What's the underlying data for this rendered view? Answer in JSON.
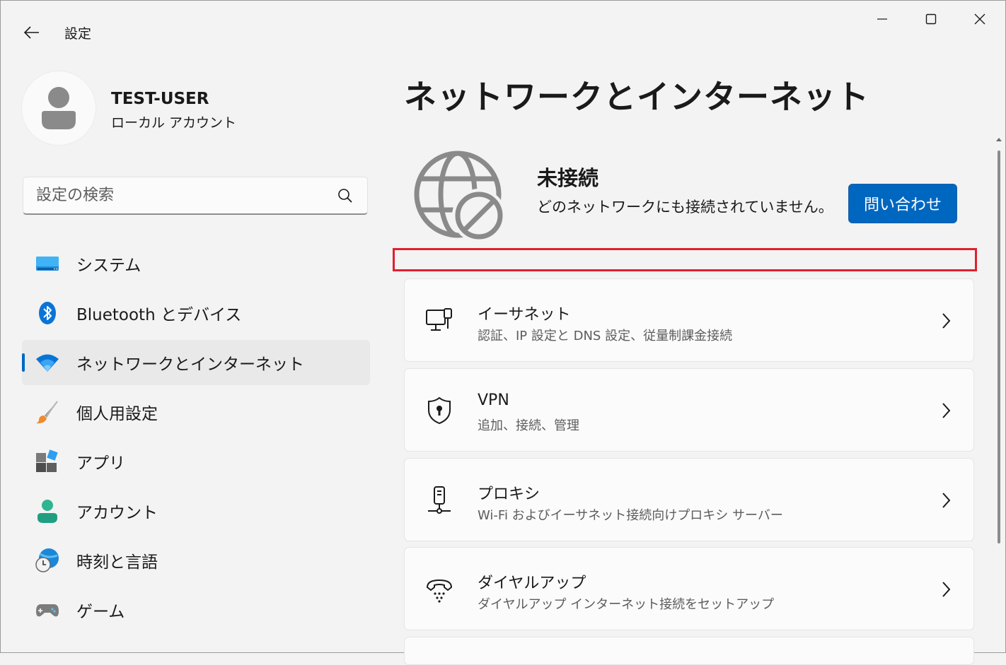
{
  "app": {
    "title": "設定"
  },
  "profile": {
    "name": "TEST-USER",
    "account_type": "ローカル アカウント"
  },
  "search": {
    "placeholder": "設定の検索"
  },
  "sidebar": {
    "items": [
      {
        "label": "システム",
        "icon": "system-icon"
      },
      {
        "label": "Bluetooth とデバイス",
        "icon": "bluetooth-icon"
      },
      {
        "label": "ネットワークとインターネット",
        "icon": "wifi-icon",
        "active": true
      },
      {
        "label": "個人用設定",
        "icon": "brush-icon"
      },
      {
        "label": "アプリ",
        "icon": "apps-icon"
      },
      {
        "label": "アカウント",
        "icon": "account-icon"
      },
      {
        "label": "時刻と言語",
        "icon": "time-language-icon"
      },
      {
        "label": "ゲーム",
        "icon": "gamepad-icon"
      }
    ]
  },
  "main": {
    "title": "ネットワークとインターネット",
    "status": {
      "title": "未接続",
      "subtitle": "どのネットワークにも接続されていません。",
      "button_label": "問い合わせ"
    },
    "cards": [
      {
        "title": "イーサネット",
        "subtitle": "認証、IP 設定と DNS 設定、従量制課金接続",
        "icon": "ethernet-icon"
      },
      {
        "title": "VPN",
        "subtitle": "追加、接続、管理",
        "icon": "vpn-shield-icon"
      },
      {
        "title": "プロキシ",
        "subtitle": "Wi-Fi およびイーサネット接続向けプロキシ サーバー",
        "icon": "proxy-icon"
      },
      {
        "title": "ダイヤルアップ",
        "subtitle": "ダイヤルアップ インターネット接続をセットアップ",
        "icon": "dialup-icon"
      }
    ]
  },
  "colors": {
    "accent": "#0067c0",
    "highlight": "#e0202e",
    "background": "#f3f3f3"
  }
}
